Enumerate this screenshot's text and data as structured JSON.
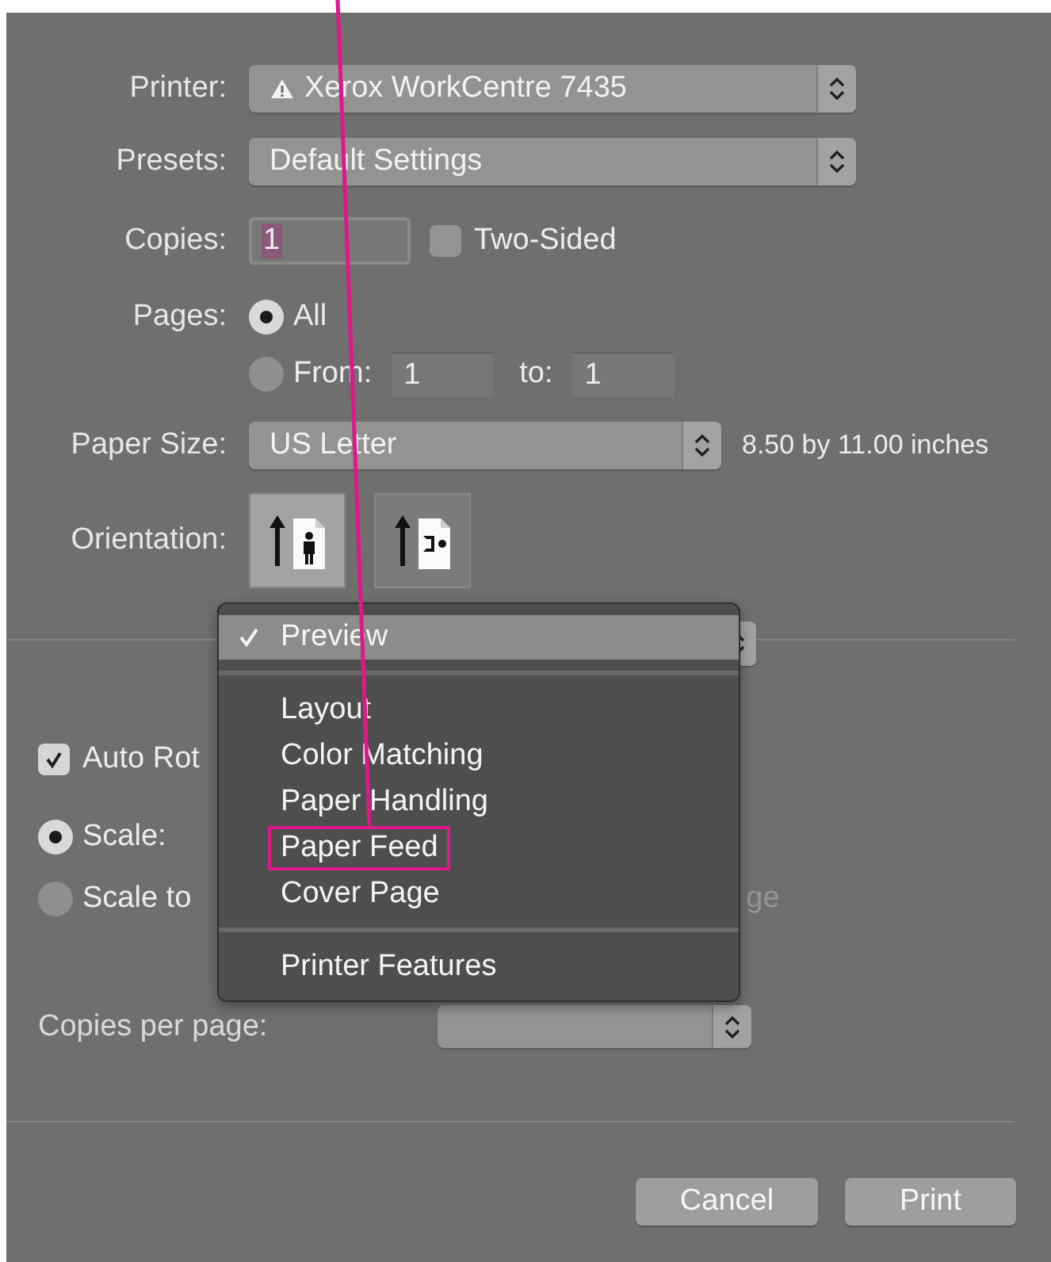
{
  "printer": {
    "label": "Printer:",
    "value": "Xerox WorkCentre 7435",
    "warning": true
  },
  "presets": {
    "label": "Presets:",
    "value": "Default Settings"
  },
  "copies": {
    "label": "Copies:",
    "value": "1"
  },
  "two_sided": {
    "label": "Two-Sided",
    "checked": false
  },
  "pages": {
    "label": "Pages:",
    "options": [
      {
        "label": "All",
        "selected": true
      },
      {
        "label": "From:",
        "selected": false
      }
    ],
    "from": "1",
    "to_label": "to:",
    "to": "1"
  },
  "paper_size": {
    "label": "Paper Size:",
    "value": "US Letter",
    "dimensions": "8.50 by 11.00 inches"
  },
  "orientation": {
    "label": "Orientation:",
    "options": [
      {
        "kind": "portrait",
        "selected": true
      },
      {
        "kind": "landscape",
        "selected": false
      }
    ]
  },
  "layout_section": {
    "auto_rotate": {
      "label": "Auto Rot",
      "checked": true
    },
    "scale_options": [
      {
        "label": "Scale:",
        "selected": true
      },
      {
        "label": "Scale to",
        "selected": false
      }
    ],
    "fit_hint": "ge",
    "copies_per_page_label": "Copies per page:"
  },
  "menu": {
    "groups": [
      [
        {
          "label": "Preview",
          "selected": true,
          "highlighted": false
        }
      ],
      [
        {
          "label": "Layout",
          "selected": false,
          "highlighted": false
        },
        {
          "label": "Color Matching",
          "selected": false,
          "highlighted": false
        },
        {
          "label": "Paper Handling",
          "selected": false,
          "highlighted": false
        },
        {
          "label": "Paper Feed",
          "selected": false,
          "highlighted": true
        },
        {
          "label": "Cover Page",
          "selected": false,
          "highlighted": false
        }
      ],
      [
        {
          "label": "Printer Features",
          "selected": false,
          "highlighted": false
        }
      ]
    ]
  },
  "annotation": {
    "pointer_to_highlight": true
  },
  "buttons": [
    {
      "label": "Cancel"
    },
    {
      "label": "Print"
    }
  ]
}
